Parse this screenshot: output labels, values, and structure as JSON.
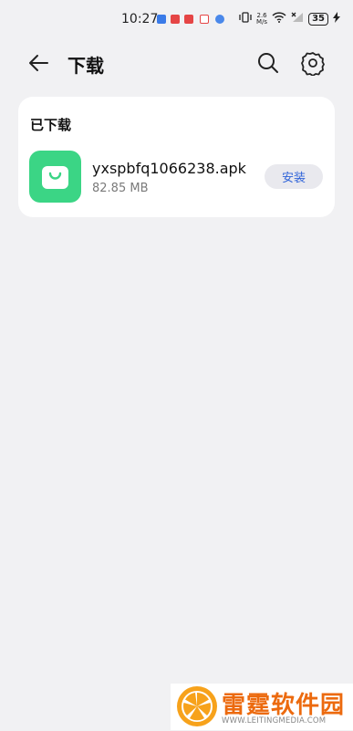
{
  "status_bar": {
    "time": "10:27",
    "net_speed_value": "2.6",
    "net_speed_unit": "M/s",
    "battery": "35"
  },
  "header": {
    "title": "下载"
  },
  "downloads": {
    "section_title": "已下载",
    "item": {
      "file_name": "yxspbfq1066238.apk",
      "file_size": "82.85 MB",
      "action_label": "安装",
      "icon_color": "#3bd585"
    }
  },
  "watermark": {
    "name_cn": "雷霆软件园",
    "url": "WWW.LEITINGMEDIA.COM"
  },
  "colors": {
    "accent": "#2f63d9",
    "background": "#f1f1f3",
    "brand_orange": "#ec6a0e"
  }
}
